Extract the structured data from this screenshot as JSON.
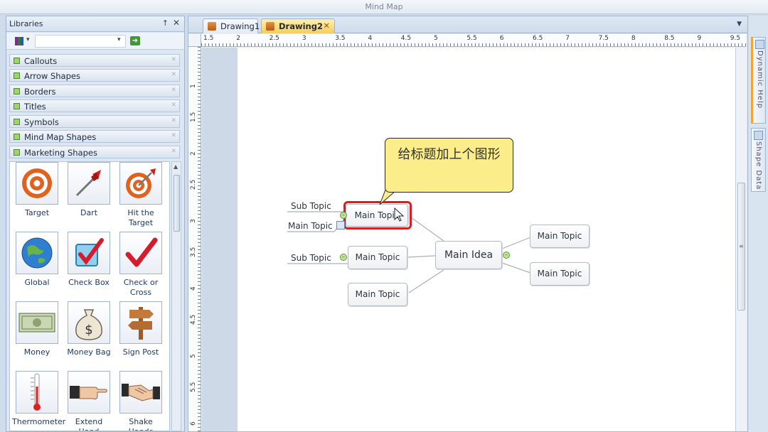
{
  "app": {
    "title": "Mind Map"
  },
  "libraries": {
    "title": "Libraries",
    "pin_glyph": "↑",
    "close_glyph": "✕",
    "search_placeholder": "",
    "categories": [
      {
        "label": "Callouts"
      },
      {
        "label": "Arrow Shapes"
      },
      {
        "label": "Borders"
      },
      {
        "label": "Titles"
      },
      {
        "label": "Symbols"
      },
      {
        "label": "Mind Map Shapes"
      },
      {
        "label": "Marketing Shapes"
      }
    ],
    "shapes": [
      {
        "label": "Target",
        "icon": "target-icon"
      },
      {
        "label": "Dart",
        "icon": "dart-icon"
      },
      {
        "label": "Hit the Target",
        "icon": "hit-target-icon"
      },
      {
        "label": "Global",
        "icon": "globe-icon"
      },
      {
        "label": "Check Box",
        "icon": "check-box-icon"
      },
      {
        "label": "Check or Cross",
        "icon": "check-mark-icon"
      },
      {
        "label": "Money",
        "icon": "money-icon"
      },
      {
        "label": "Money Bag",
        "icon": "money-bag-icon"
      },
      {
        "label": "Sign Post",
        "icon": "sign-post-icon"
      },
      {
        "label": "Thermometer",
        "icon": "thermometer-icon"
      },
      {
        "label": "Extend Hand",
        "icon": "extend-hand-icon"
      },
      {
        "label": "Shake Hands",
        "icon": "shake-hands-icon"
      }
    ]
  },
  "tabs": [
    {
      "label": "Drawing1",
      "active": false
    },
    {
      "label": "Drawing2",
      "active": true,
      "close_glyph": "✕"
    }
  ],
  "ruler": {
    "horizontal": [
      "1.5",
      "2",
      "2.5",
      "3",
      "3.5",
      "4",
      "4.5",
      "5",
      "5.5",
      "6",
      "6.5",
      "7",
      "7.5",
      "8",
      "8.5",
      "9",
      "9.5"
    ],
    "vertical": [
      "1",
      "1.5",
      "2",
      "2.5",
      "3",
      "3.5",
      "4",
      "4.5",
      "5",
      "5.5",
      "6"
    ]
  },
  "mindmap": {
    "main_idea": "Main Idea",
    "topics": {
      "selected": "Main Topic",
      "left_middle": "Main Topic",
      "left_bottom": "Main Topic",
      "right_top": "Main Topic",
      "right_bottom": "Main Topic"
    },
    "subtopics": {
      "sub1": "Sub Topic",
      "sub2": "Main Topic",
      "sub3": "Sub Topic"
    },
    "callout_text": "给标题加上个图形",
    "colors": {
      "selection": "#d32020",
      "callout_fill": "#fbee8a",
      "connector": "#a8b0ba"
    }
  },
  "side_panes": [
    {
      "label": "Dynamic Help"
    },
    {
      "label": "Shape Data"
    }
  ]
}
